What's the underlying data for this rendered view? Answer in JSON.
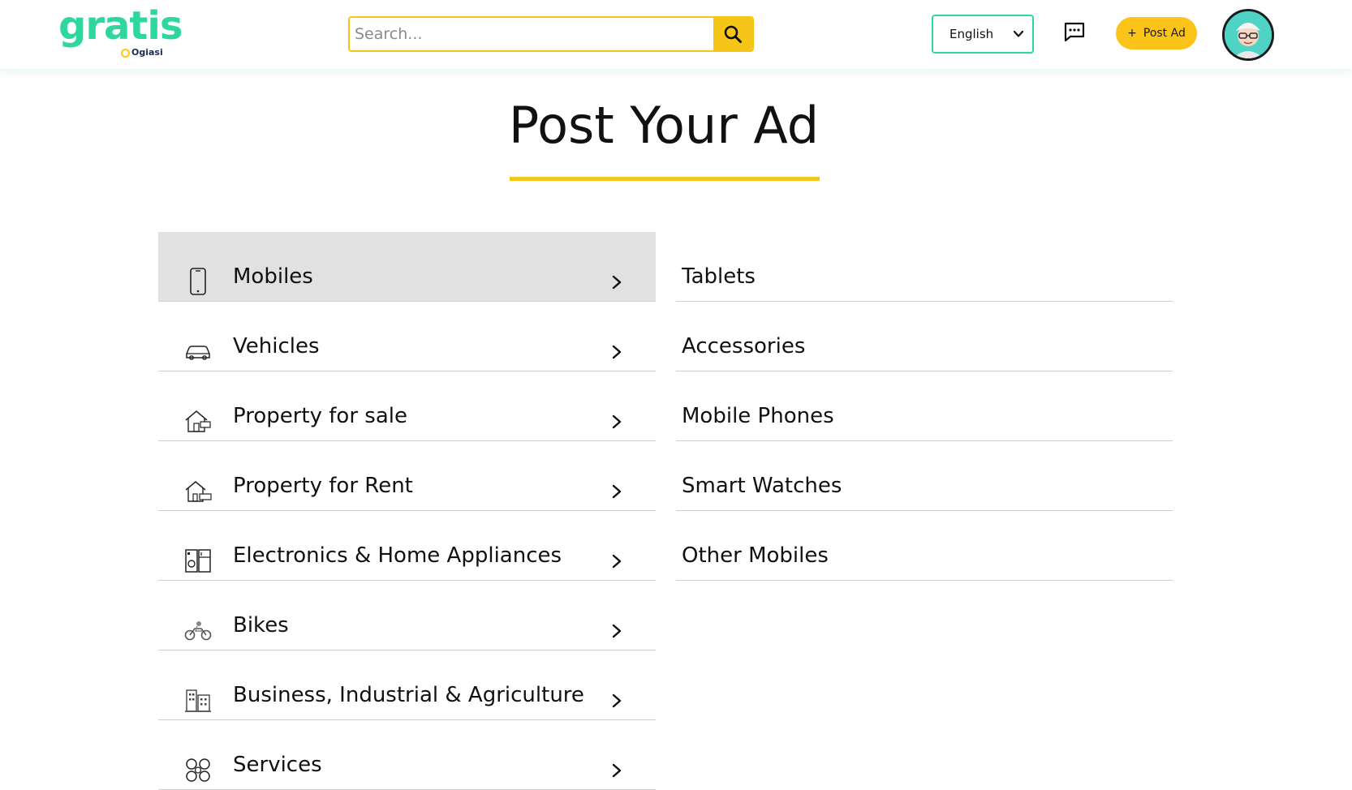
{
  "header": {
    "logo_text": "gratis",
    "logo_sub": "Ogiasi",
    "search_placeholder": "Search...",
    "language": "English",
    "post_button_label": "Post Ad",
    "post_button_plus": "+"
  },
  "main": {
    "title": "Post Your Ad",
    "categories": [
      {
        "label": "Mobiles",
        "icon": "mobile-icon",
        "active": true
      },
      {
        "label": "Vehicles",
        "icon": "car-icon"
      },
      {
        "label": "Property for sale",
        "icon": "house-sale-icon"
      },
      {
        "label": "Property for Rent",
        "icon": "house-rent-icon"
      },
      {
        "label": "Electronics & Home Appliances",
        "icon": "appliances-icon"
      },
      {
        "label": "Bikes",
        "icon": "bike-icon"
      },
      {
        "label": "Business, Industrial & Agriculture",
        "icon": "building-icon"
      },
      {
        "label": "Services",
        "icon": "services-icon"
      }
    ],
    "subcategories": [
      {
        "label": "Tablets"
      },
      {
        "label": "Accessories"
      },
      {
        "label": "Mobile Phones"
      },
      {
        "label": "Smart Watches"
      },
      {
        "label": "Other Mobiles"
      }
    ]
  },
  "colors": {
    "brand_green": "#2fd7a0",
    "accent_yellow": "#f5c518",
    "active_row": "#e1e1e1"
  }
}
